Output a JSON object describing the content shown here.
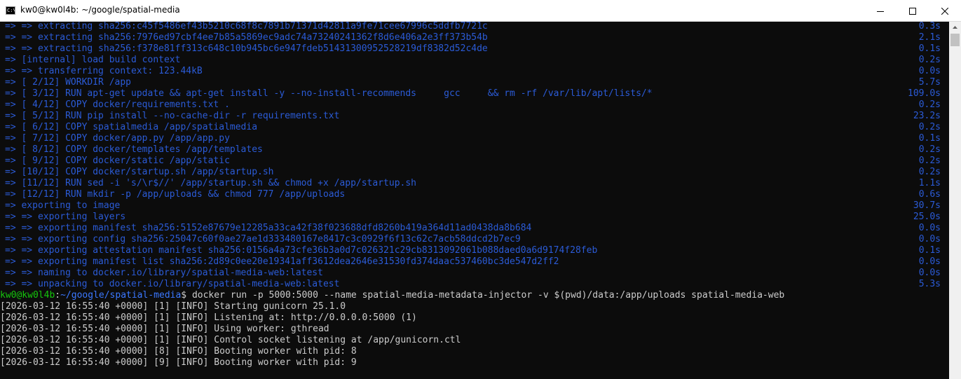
{
  "window": {
    "title": "kw0@kw0l4b: ~/google/spatial-media",
    "icon_label": "C:\\.",
    "icon_name": "console-app-icon",
    "controls": {
      "minimize": "minimize-icon",
      "maximize": "maximize-icon",
      "close": "close-icon"
    }
  },
  "colors": {
    "background": "#0c0c0c",
    "build_output": "#2b5bd7",
    "plain_output": "#cccccc",
    "prompt_user": "#16c60c",
    "prompt_path": "#3b78ff"
  },
  "build_lines": [
    {
      "text": "=> => extracting sha256:c45f5486ef43b5210c68f8c7891b71371d42811a9fe71cee67996c5ddfb7721c",
      "duration": "0.3s"
    },
    {
      "text": "=> => extracting sha256:7976ed97cbf4ee7b85a5869ec9adc74a73240241362f8d6e406a2e3ff373b54b",
      "duration": "2.1s"
    },
    {
      "text": "=> => extracting sha256:f378e81ff313c648c10b945bc6e947fdeb51431300952528219df8382d52c4de",
      "duration": "0.1s"
    },
    {
      "text": "=> [internal] load build context",
      "duration": "0.2s"
    },
    {
      "text": "=> => transferring context: 123.44kB",
      "duration": "0.0s"
    },
    {
      "text": "=> [ 2/12] WORKDIR /app",
      "duration": "5.7s"
    },
    {
      "text": "=> [ 3/12] RUN apt-get update && apt-get install -y --no-install-recommends     gcc     && rm -rf /var/lib/apt/lists/*",
      "duration": "109.0s"
    },
    {
      "text": "=> [ 4/12] COPY docker/requirements.txt .",
      "duration": "0.2s"
    },
    {
      "text": "=> [ 5/12] RUN pip install --no-cache-dir -r requirements.txt",
      "duration": "23.2s"
    },
    {
      "text": "=> [ 6/12] COPY spatialmedia /app/spatialmedia",
      "duration": "0.2s"
    },
    {
      "text": "=> [ 7/12] COPY docker/app.py /app/app.py",
      "duration": "0.1s"
    },
    {
      "text": "=> [ 8/12] COPY docker/templates /app/templates",
      "duration": "0.2s"
    },
    {
      "text": "=> [ 9/12] COPY docker/static /app/static",
      "duration": "0.2s"
    },
    {
      "text": "=> [10/12] COPY docker/startup.sh /app/startup.sh",
      "duration": "0.2s"
    },
    {
      "text": "=> [11/12] RUN sed -i 's/\\r$//' /app/startup.sh && chmod +x /app/startup.sh",
      "duration": "1.1s"
    },
    {
      "text": "=> [12/12] RUN mkdir -p /app/uploads && chmod 777 /app/uploads",
      "duration": "0.6s"
    },
    {
      "text": "=> exporting to image",
      "duration": "30.7s"
    },
    {
      "text": "=> => exporting layers",
      "duration": "25.0s"
    },
    {
      "text": "=> => exporting manifest sha256:5152e87679e12285a33ca42f38f023688dfd8260b419a364d11ad0438da8b684",
      "duration": "0.0s"
    },
    {
      "text": "=> => exporting config sha256:25047c60f0ae27ae1d333480167e8417c3c0929f6f13c62c7acb58ddcd2b7ec9",
      "duration": "0.0s"
    },
    {
      "text": "=> => exporting attestation manifest sha256:0156a4a73cfe36b3a0d7c026321c29cb8313092061b088daed0a6d9174f28feb",
      "duration": "0.1s"
    },
    {
      "text": "=> => exporting manifest list sha256:2d89c0ee20e19341aff3612dea2646e31530fd374daac537460bc3de547d2ff2",
      "duration": "0.0s"
    },
    {
      "text": "=> => naming to docker.io/library/spatial-media-web:latest",
      "duration": "0.0s"
    },
    {
      "text": "=> => unpacking to docker.io/library/spatial-media-web:latest",
      "duration": "5.3s"
    }
  ],
  "prompt": {
    "user_host": "kw0@kw0l4b",
    "separator": ":",
    "path": "~/google/spatial-media",
    "symbol": "$",
    "command": " docker run -p 5000:5000 --name spatial-media-metadata-injector -v $(pwd)/data:/app/uploads spatial-media-web"
  },
  "log_lines": [
    "[2026-03-12 16:55:40 +0000] [1] [INFO] Starting gunicorn 25.1.0",
    "[2026-03-12 16:55:40 +0000] [1] [INFO] Listening at: http://0.0.0.0:5000 (1)",
    "[2026-03-12 16:55:40 +0000] [1] [INFO] Using worker: gthread",
    "[2026-03-12 16:55:40 +0000] [1] [INFO] Control socket listening at /app/gunicorn.ctl",
    "[2026-03-12 16:55:40 +0000] [8] [INFO] Booting worker with pid: 8",
    "[2026-03-12 16:55:40 +0000] [9] [INFO] Booting worker with pid: 9"
  ],
  "scrollbar": {
    "up_arrow": "scroll-up-arrow-icon"
  }
}
